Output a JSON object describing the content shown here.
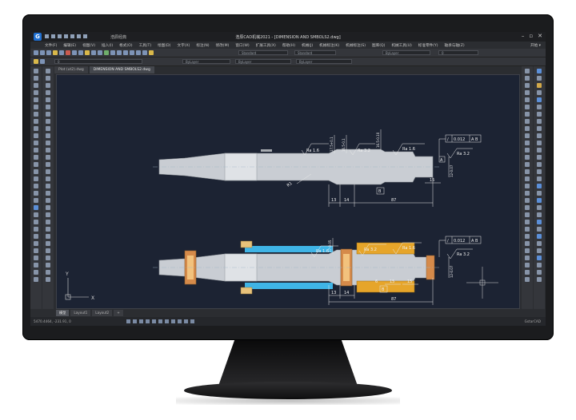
{
  "window": {
    "title": "浩辰CAD机械2021 - [DIMENSION AND SMBOLS2.dwg]",
    "workspace": "浩辰经典",
    "controls": [
      "–",
      "▫",
      "✕"
    ]
  },
  "menu": {
    "items": [
      "文件(F)",
      "编辑(E)",
      "视图(V)",
      "插入(I)",
      "格式(O)",
      "工具(T)",
      "绘图(D)",
      "文字(X)",
      "标注(N)",
      "修改(M)",
      "窗口(W)",
      "扩展工具(X)",
      "帮助(H)",
      "机械(J)",
      "机械标注(K)",
      "机械标注(S)",
      "图库(Q)",
      "机械工具(U)",
      "标准零件(Y)",
      "轴承与轴(Z)"
    ],
    "right_label": "开始 ▾"
  },
  "toolbar": {
    "layer_combo": "ByLayer",
    "style_combo1": "Standard",
    "style_combo2": "Standard",
    "linetype_combo": "ByLayer",
    "lineweight_combo": "ByLayer",
    "color_combo": "ByLayer",
    "layer_name": "0"
  },
  "file_tabs": [
    {
      "label": "Plot (ut2).dwg",
      "active": false
    },
    {
      "label": "DIMENSION AND SMBOLS2.dwg",
      "active": true
    }
  ],
  "layout_tabs": [
    {
      "label": "模型",
      "active": true
    },
    {
      "label": "Layout1",
      "active": false
    },
    {
      "label": "Layout2",
      "active": false
    },
    {
      "label": "+",
      "active": false
    }
  ],
  "statusbar": {
    "coords": "5470.4464, -231.91, 0",
    "right": "GstarCAD"
  },
  "drawing": {
    "top": {
      "ra_left": "Ra 1.6",
      "ra_mid": "Ra 3.2",
      "ra_right": "Ra 1.6",
      "ra_far": "Ra 3.2",
      "tolerance_symbol": "/",
      "tolerance_value": "0.012",
      "tolerance_datum": "A B",
      "dim_13": "13",
      "dim_14": "14",
      "dim_87": "87",
      "dim_15": "15",
      "dim_vert1": "17.5+0.1",
      "dim_vert2": "16.5-0.1",
      "dim_vert3": "16.5-0.10",
      "dim_vert4": "12-0.07",
      "radius": "R1",
      "datum_b": "B",
      "datum_a": "A"
    },
    "bottom": {
      "ra_left": "Ra 1.6",
      "ra_mid": "Ra 3.2",
      "ra_right": "Ra 1.6",
      "ra_far": "Ra 3.2",
      "tolerance_symbol": "/",
      "tolerance_value": "0.012",
      "tolerance_datum": "A B",
      "dim_13": "13",
      "dim_14": "14",
      "dim_87": "87",
      "dim_15a": "15",
      "dim_15b": "15",
      "dim_6": "6",
      "dim_vert1": "17-0.05",
      "dim_vert4": "12-0.07",
      "datum_b": "B"
    },
    "ucs": {
      "x": "X",
      "y": "Y"
    }
  }
}
